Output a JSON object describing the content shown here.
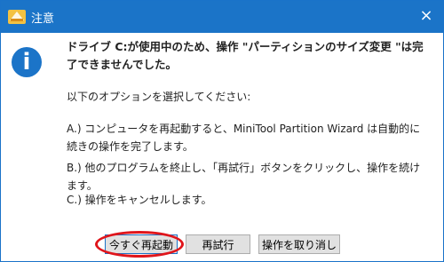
{
  "dialog": {
    "title": "注意",
    "headline": "ドライブ C:が使用中のため、操作 \"パーティションのサイズ変更 \"は完了できませんでした。",
    "intro": "以下のオプションを選択してください:",
    "option_a": "A.) コンピュータを再起動すると、MiniTool Partition Wizard は自動的に続きの操作を完了します。",
    "option_b": "B.) 他のプログラムを終止し、「再試行」ボタンをクリックし、操作を続けます。",
    "option_c": "C.) 操作をキャンセルします。"
  },
  "buttons": {
    "restart_label": "今すぐ再起動",
    "retry_label": "再試行",
    "cancel_label": "操作を取り消し"
  },
  "colors": {
    "titlebar": "#1b74c8",
    "highlight": "#e0151b"
  }
}
